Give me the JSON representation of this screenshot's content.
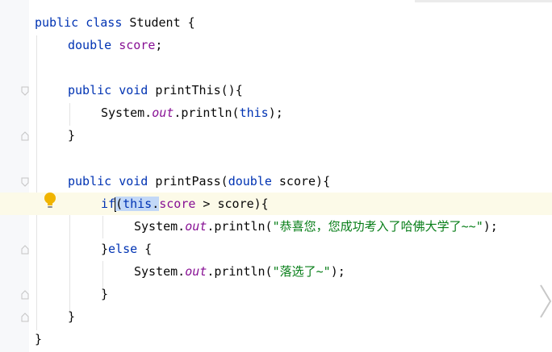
{
  "colors": {
    "keyword": "#0033b3",
    "field": "#871094",
    "string": "#067d17",
    "text": "#080808",
    "current_line": "#fcfae8",
    "selection": "#c2d8f7"
  },
  "icons": {
    "intention": "lightbulb-icon",
    "fold": "fold-marker-icon",
    "nav": "chevron-right-icon"
  },
  "code": {
    "l1": {
      "kw": "public class",
      "rest": " Student {"
    },
    "l2": {
      "type": "double",
      "sp": " ",
      "field": "score",
      "semi": ";"
    },
    "l4": {
      "kw": "public void",
      "rest": " printThis(){"
    },
    "l5": {
      "a": "System.",
      "static": "out",
      "b": ".println(",
      "kw": "this",
      "c": ");"
    },
    "l6": {
      "brace": "}"
    },
    "l8": {
      "kw": "public void",
      "a": " printPass(",
      "type": "double",
      "b": " score){"
    },
    "l9": {
      "kw_if": "if",
      "paren": "(",
      "kw_this": "this",
      "dot": ".",
      "field": "score",
      "rest": " > score){"
    },
    "l10": {
      "a": "System.",
      "static": "out",
      "b": ".println(",
      "str": "\"恭喜您，您成功考入了哈佛大学了~~\"",
      "c": ");"
    },
    "l11": {
      "a": "}",
      "kw": "else",
      "b": " {"
    },
    "l12": {
      "a": "System.",
      "static": "out",
      "b": ".println(",
      "str": "\"落选了~\"",
      "c": ");"
    },
    "l13": {
      "brace": "}"
    },
    "l14": {
      "brace": "}"
    },
    "l15": {
      "brace": "}"
    }
  }
}
